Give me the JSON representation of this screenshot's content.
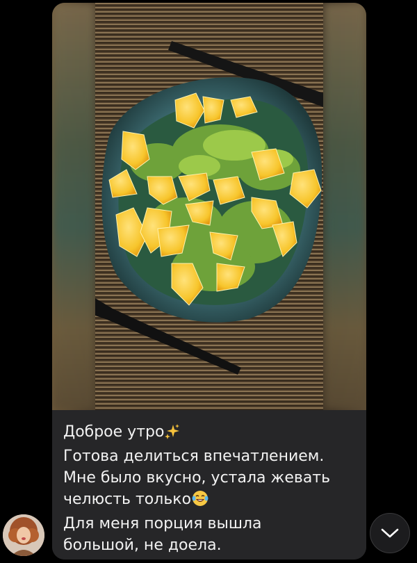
{
  "message": {
    "caption_lines": [
      "Доброе утро",
      "Готова делиться впечатлением.",
      "Мне было вкусно, устала жевать",
      "челюсть только",
      "Для меня порция вышла",
      "большой, не доела."
    ],
    "line_emojis": {
      "0": "sparkles-icon",
      "3": "laughing-tears-icon"
    }
  },
  "colors": {
    "background": "#000000",
    "bubble": "#262628",
    "text": "#f2f2f2",
    "scroll_button": "#1c1c1e"
  },
  "icons": {
    "scroll_down": "chevron-down-icon",
    "avatar": "avatar"
  }
}
